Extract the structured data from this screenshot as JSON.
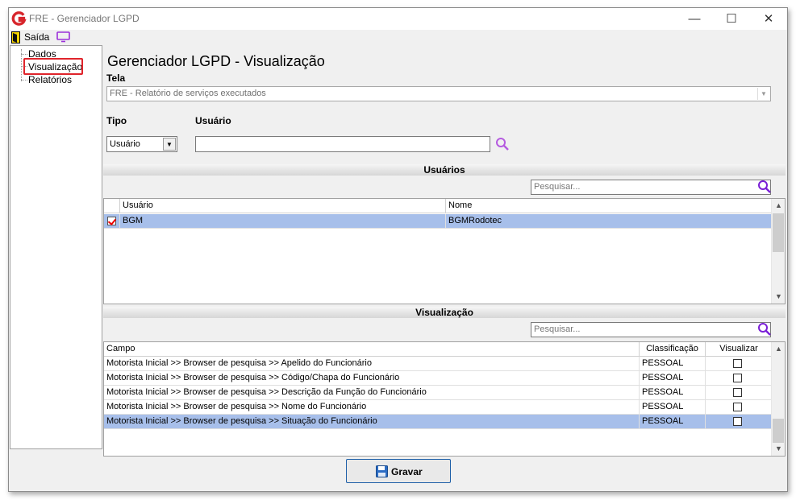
{
  "window": {
    "title": "FRE - Gerenciador LGPD",
    "minimize_glyph": "—",
    "maximize_glyph": "☐",
    "close_glyph": "✕"
  },
  "toolbar": {
    "exit_label": "Saída"
  },
  "tree": {
    "items": [
      "Dados",
      "Visualização",
      "Relatórios"
    ],
    "selected": "Visualização",
    "highlight_color": "#e0242b"
  },
  "page": {
    "title": "Gerenciador LGPD - Visualização"
  },
  "form": {
    "tela_label": "Tela",
    "tela_value": "FRE - Relatório de serviços executados",
    "tipo_label": "Tipo",
    "tipo_value": "Usuário",
    "usuario_label": "Usuário",
    "usuario_value": ""
  },
  "usuarios_section": {
    "title": "Usuários",
    "search_placeholder": "Pesquisar...",
    "columns": [
      "Usuário",
      "Nome"
    ],
    "rows": [
      {
        "checked": true,
        "usuario": "BGM",
        "nome": "BGMRodotec",
        "selected": true
      }
    ]
  },
  "visualizacao_section": {
    "title": "Visualização",
    "search_placeholder": "Pesquisar...",
    "columns": [
      "Campo",
      "Classificação",
      "Visualizar"
    ],
    "rows": [
      {
        "campo": "Motorista Inicial >> Browser de pesquisa >> Apelido do Funcionário",
        "classificacao": "PESSOAL",
        "visualizar": false,
        "selected": false
      },
      {
        "campo": "Motorista Inicial >> Browser de pesquisa >> Código/Chapa do Funcionário",
        "classificacao": "PESSOAL",
        "visualizar": false,
        "selected": false
      },
      {
        "campo": "Motorista Inicial >> Browser de pesquisa >> Descrição da Função do Funcionário",
        "classificacao": "PESSOAL",
        "visualizar": false,
        "selected": false
      },
      {
        "campo": "Motorista Inicial >> Browser de pesquisa >> Nome do Funcionário",
        "classificacao": "PESSOAL",
        "visualizar": false,
        "selected": false
      },
      {
        "campo": "Motorista Inicial >> Browser de pesquisa >> Situação do Funcionário",
        "classificacao": "PESSOAL",
        "visualizar": false,
        "selected": true
      }
    ]
  },
  "footer": {
    "save_label": "Gravar"
  },
  "colors": {
    "selection_row": "#a7bfea",
    "search_icon": "#8a2be2",
    "button_border": "#1e5fa8"
  },
  "icons": {
    "logo": "app-logo-icon",
    "exit": "exit-door-icon",
    "monitor": "monitor-icon",
    "search": "search-icon",
    "save": "floppy-disk-icon"
  }
}
